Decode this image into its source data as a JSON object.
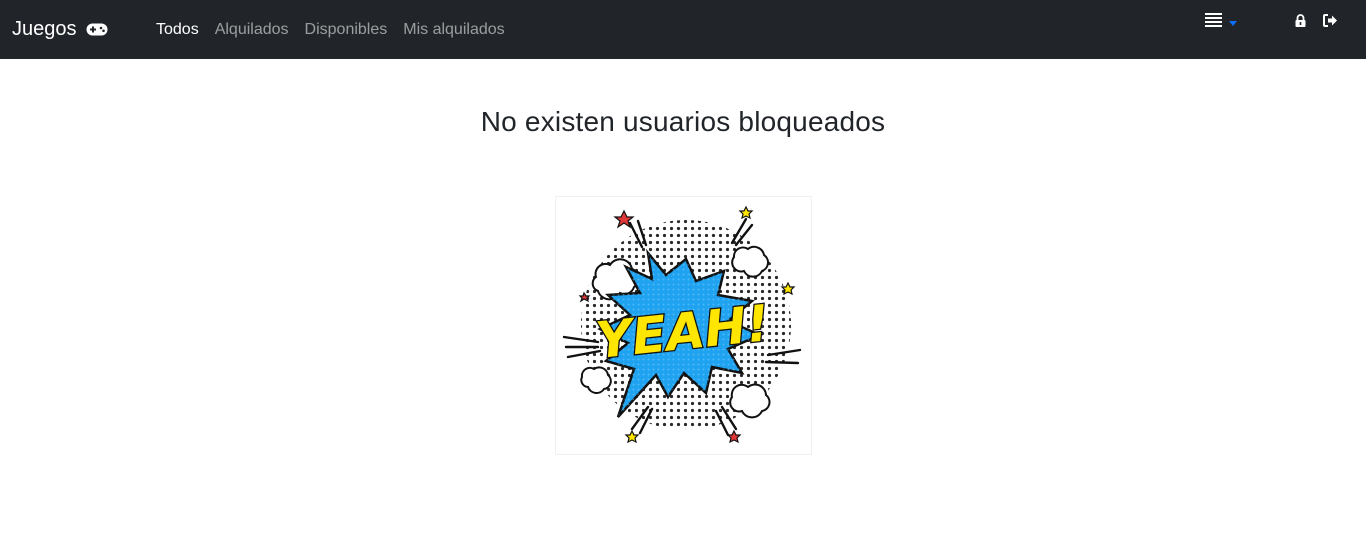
{
  "navbar": {
    "brand": "Juegos",
    "brand_icon": "gamepad-icon",
    "links": [
      {
        "label": "Todos",
        "active": true
      },
      {
        "label": "Alquilados",
        "active": false
      },
      {
        "label": "Disponibles",
        "active": false
      },
      {
        "label": "Mis alquilados",
        "active": false
      }
    ],
    "right_icons": [
      "list-menu-icon",
      "caret-down-icon",
      "lock-icon",
      "sign-out-icon"
    ]
  },
  "main": {
    "title": "No existen usuarios bloqueados",
    "image_text": "YEAH!"
  },
  "colors": {
    "navbar_bg": "#212529",
    "burst_blue": "#1fa2f0",
    "burst_text": "#ffe600",
    "caret_blue": "#0d6efd"
  }
}
